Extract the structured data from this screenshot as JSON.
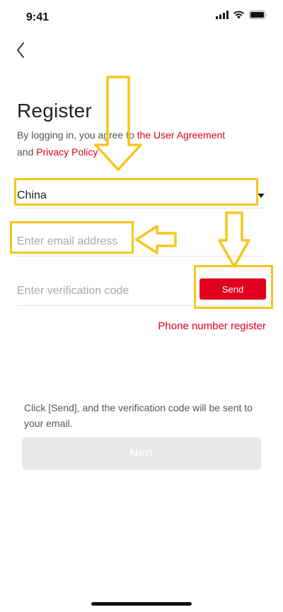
{
  "status_bar": {
    "time": "9:41",
    "icons": [
      "cellular-signal-icon",
      "wifi-icon",
      "battery-icon"
    ]
  },
  "nav": {
    "back_icon": "chevron-left-icon"
  },
  "header": {
    "title": "Register"
  },
  "agreement": {
    "prefix": "By logging in, you agree to ",
    "user_agreement_link": "the User Agreement",
    "conjunction": " and ",
    "privacy_link": "Privacy Policy"
  },
  "form": {
    "country": {
      "value": "China",
      "icon": "caret-down-icon"
    },
    "email": {
      "value": "",
      "placeholder": "Enter email address"
    },
    "verification": {
      "value": "",
      "placeholder": "Enter verification code",
      "send_label": "Send"
    },
    "alt_register_label": "Phone number register"
  },
  "hint": "Click [Send], and the verification code will be sent to your email.",
  "next_label": "Next",
  "colors": {
    "accent": "#e1001e",
    "annotation": "#f7c51b",
    "disabled_button": "#e8e8e8",
    "placeholder": "#a8a8a8"
  }
}
